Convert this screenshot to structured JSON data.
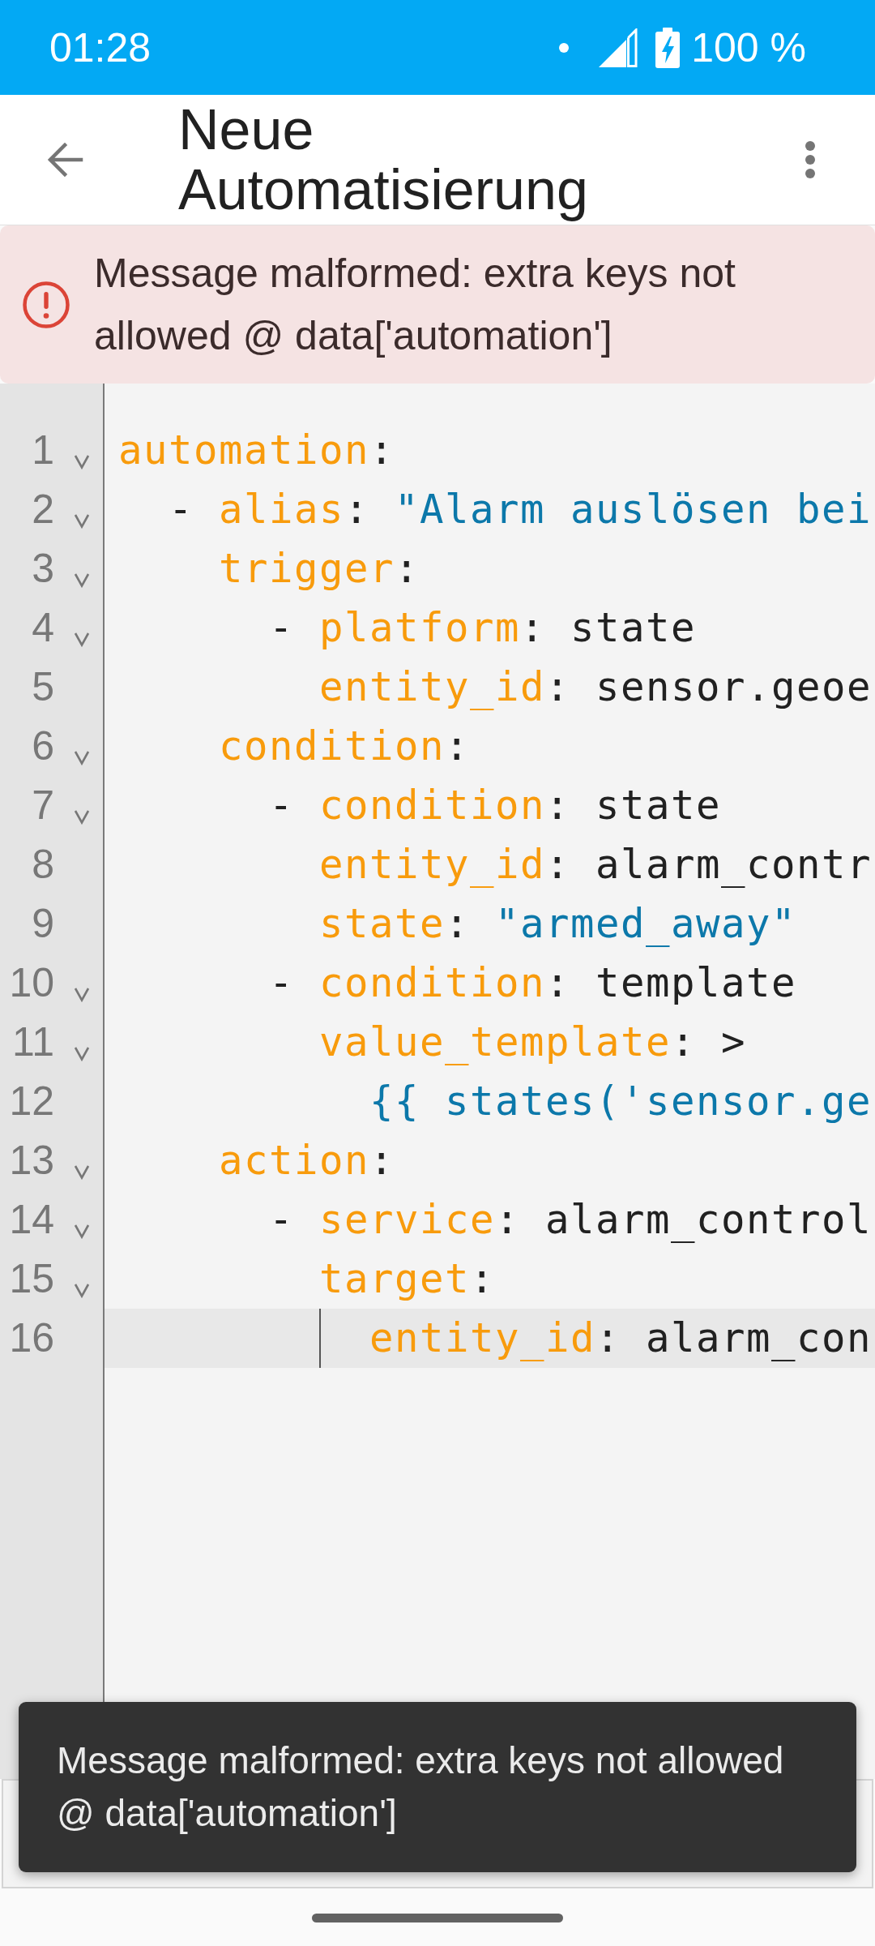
{
  "status_bar": {
    "time": "01:28",
    "battery": "100 %"
  },
  "app_bar": {
    "title": "Neue Automatisierung"
  },
  "alert": {
    "kind": "error",
    "message": "Message malformed: extra keys not allowed @ data['automation']"
  },
  "editor": {
    "lines": [
      {
        "number": "1",
        "foldable": true,
        "active": false,
        "cursor": false,
        "tokens": [
          {
            "kind": "key",
            "text": "automation"
          },
          {
            "kind": "plain",
            "text": ":"
          }
        ]
      },
      {
        "number": "2",
        "foldable": true,
        "active": false,
        "cursor": false,
        "tokens": [
          {
            "kind": "plain",
            "text": "  - "
          },
          {
            "kind": "key",
            "text": "alias"
          },
          {
            "kind": "plain",
            "text": ": "
          },
          {
            "kind": "string",
            "text": "\"Alarm auslösen bei"
          }
        ]
      },
      {
        "number": "3",
        "foldable": true,
        "active": false,
        "cursor": false,
        "tokens": [
          {
            "kind": "key",
            "text": "    trigger"
          },
          {
            "kind": "plain",
            "text": ":"
          }
        ]
      },
      {
        "number": "4",
        "foldable": true,
        "active": false,
        "cursor": false,
        "tokens": [
          {
            "kind": "plain",
            "text": "      - "
          },
          {
            "kind": "key",
            "text": "platform"
          },
          {
            "kind": "plain",
            "text": ": state"
          }
        ]
      },
      {
        "number": "5",
        "foldable": false,
        "active": false,
        "cursor": false,
        "tokens": [
          {
            "kind": "key",
            "text": "        entity_id"
          },
          {
            "kind": "plain",
            "text": ": sensor.geoe"
          }
        ]
      },
      {
        "number": "6",
        "foldable": true,
        "active": false,
        "cursor": false,
        "tokens": [
          {
            "kind": "key",
            "text": "    condition"
          },
          {
            "kind": "plain",
            "text": ":"
          }
        ]
      },
      {
        "number": "7",
        "foldable": true,
        "active": false,
        "cursor": false,
        "tokens": [
          {
            "kind": "plain",
            "text": "      - "
          },
          {
            "kind": "key",
            "text": "condition"
          },
          {
            "kind": "plain",
            "text": ": state"
          }
        ]
      },
      {
        "number": "8",
        "foldable": false,
        "active": false,
        "cursor": false,
        "tokens": [
          {
            "kind": "key",
            "text": "        entity_id"
          },
          {
            "kind": "plain",
            "text": ": alarm_contr"
          }
        ]
      },
      {
        "number": "9",
        "foldable": false,
        "active": false,
        "cursor": false,
        "tokens": [
          {
            "kind": "key",
            "text": "        state"
          },
          {
            "kind": "plain",
            "text": ": "
          },
          {
            "kind": "string",
            "text": "\"armed_away\""
          }
        ]
      },
      {
        "number": "10",
        "foldable": true,
        "active": false,
        "cursor": false,
        "tokens": [
          {
            "kind": "plain",
            "text": "      - "
          },
          {
            "kind": "key",
            "text": "condition"
          },
          {
            "kind": "plain",
            "text": ": template"
          }
        ]
      },
      {
        "number": "11",
        "foldable": true,
        "active": false,
        "cursor": false,
        "tokens": [
          {
            "kind": "key",
            "text": "        value_template"
          },
          {
            "kind": "plain",
            "text": ": >"
          }
        ]
      },
      {
        "number": "12",
        "foldable": false,
        "active": false,
        "cursor": false,
        "tokens": [
          {
            "kind": "string",
            "text": "          {{ states('sensor.ge"
          }
        ]
      },
      {
        "number": "13",
        "foldable": true,
        "active": false,
        "cursor": false,
        "tokens": [
          {
            "kind": "key",
            "text": "    action"
          },
          {
            "kind": "plain",
            "text": ":"
          }
        ]
      },
      {
        "number": "14",
        "foldable": true,
        "active": false,
        "cursor": false,
        "tokens": [
          {
            "kind": "plain",
            "text": "      - "
          },
          {
            "kind": "key",
            "text": "service"
          },
          {
            "kind": "plain",
            "text": ": alarm_control"
          }
        ]
      },
      {
        "number": "15",
        "foldable": true,
        "active": false,
        "cursor": false,
        "tokens": [
          {
            "kind": "key",
            "text": "        target"
          },
          {
            "kind": "plain",
            "text": ":"
          }
        ]
      },
      {
        "number": "16",
        "foldable": false,
        "active": true,
        "cursor": true,
        "tokens": [
          {
            "kind": "key",
            "text": "          entity_id"
          },
          {
            "kind": "plain",
            "text": ": alarm_con"
          }
        ]
      }
    ]
  },
  "snackbar": {
    "message": "Message malformed: extra keys not allowed @ data['automation']"
  }
}
